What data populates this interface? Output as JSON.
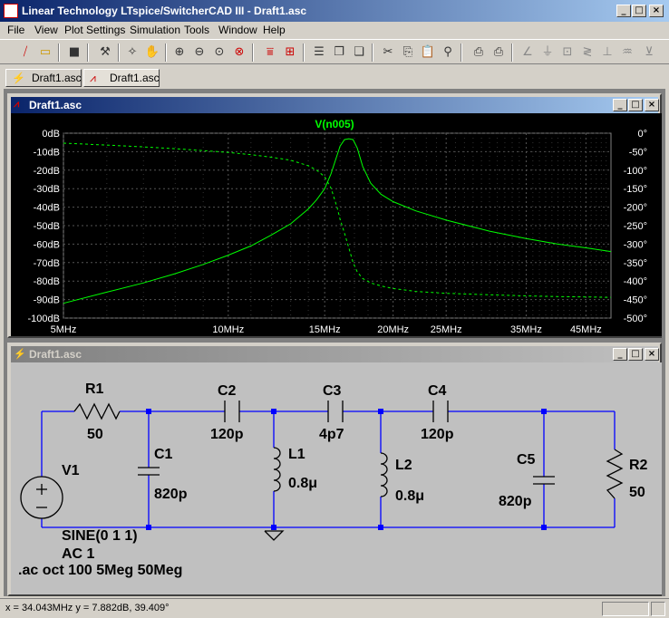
{
  "app": {
    "title": "Linear Technology LTspice/SwitcherCAD III - Draft1.asc",
    "min": "_",
    "max": "□",
    "close": "×"
  },
  "menu": [
    "File",
    "View",
    "Plot Settings",
    "Simulation",
    "Tools",
    "Window",
    "Help"
  ],
  "tabs": [
    {
      "label": "Draft1.asc",
      "icon": "schematic-icon"
    },
    {
      "label": "Draft1.asc",
      "icon": "waveform-icon"
    }
  ],
  "plot_window": {
    "title": "Draft1.asc",
    "trace_name": "V(n005)"
  },
  "schematic_window": {
    "title": "Draft1.asc"
  },
  "chart_data": {
    "type": "line",
    "title": "V(n005)",
    "x_scale": "log",
    "x_tick_labels": [
      "5MHz",
      "10MHz",
      "15MHz",
      "20MHz",
      "25MHz",
      "35MHz",
      "45MHz"
    ],
    "x_ticks": [
      5,
      10,
      15,
      20,
      25,
      35,
      45
    ],
    "xlim": [
      5,
      50
    ],
    "y_left_ticks": [
      "0dB",
      "-10dB",
      "-20dB",
      "-30dB",
      "-40dB",
      "-50dB",
      "-60dB",
      "-70dB",
      "-80dB",
      "-90dB",
      "-100dB"
    ],
    "ylim_left": [
      -100,
      0
    ],
    "y_right_ticks": [
      "0°",
      "-50°",
      "-100°",
      "-150°",
      "-200°",
      "-250°",
      "-300°",
      "-350°",
      "-400°",
      "-450°",
      "-500°"
    ],
    "ylim_right": [
      -500,
      0
    ],
    "grid": true,
    "series": [
      {
        "style": "solid",
        "axis": "left",
        "x": [
          5,
          6,
          7,
          8,
          9,
          10,
          11,
          12,
          13,
          14,
          14.5,
          15,
          15.4,
          15.8,
          16.0,
          16.3,
          16.6,
          16.9,
          17.2,
          17.6,
          18.2,
          19,
          20,
          22,
          25,
          30,
          35,
          40,
          45,
          50
        ],
        "y": [
          -92,
          -86,
          -81,
          -76,
          -71,
          -66,
          -61,
          -55,
          -49,
          -41,
          -36,
          -30,
          -22,
          -12,
          -7,
          -3.5,
          -3,
          -3.5,
          -8,
          -18,
          -27,
          -33,
          -37,
          -42,
          -47,
          -53,
          -57,
          -60,
          -62,
          -64
        ]
      },
      {
        "style": "dashed",
        "axis": "right",
        "x": [
          5,
          6,
          7,
          8,
          9,
          10,
          11,
          12,
          13,
          14,
          14.5,
          15,
          15.4,
          15.8,
          16.0,
          16.3,
          16.6,
          16.9,
          17.2,
          17.6,
          18.2,
          19,
          20,
          22,
          25,
          30,
          35,
          40,
          45,
          50
        ],
        "y": [
          -27,
          -32,
          -37,
          -42,
          -47,
          -52,
          -58,
          -65,
          -73,
          -88,
          -100,
          -118,
          -148,
          -200,
          -232,
          -270,
          -310,
          -350,
          -375,
          -393,
          -405,
          -413,
          -420,
          -428,
          -433,
          -437,
          -440,
          -442,
          -443,
          -444
        ]
      }
    ]
  },
  "schematic": {
    "components": {
      "r1": {
        "name": "R1",
        "value": "50"
      },
      "c1": {
        "name": "C1",
        "value": "820p"
      },
      "c2": {
        "name": "C2",
        "value": "120p"
      },
      "c3": {
        "name": "C3",
        "value": "4p7"
      },
      "c4": {
        "name": "C4",
        "value": "120p"
      },
      "c5": {
        "name": "C5",
        "value": "820p"
      },
      "l1": {
        "name": "L1",
        "value": "0.8μ"
      },
      "l2": {
        "name": "L2",
        "value": "0.8μ"
      },
      "r2": {
        "name": "R2",
        "value": "50"
      },
      "v1": {
        "name": "V1",
        "value": "SINE(0 1 1)",
        "ac": "AC 1"
      }
    },
    "directive": ".ac oct 100 5Meg 50Meg",
    "colors": {
      "wire": "#0000ff",
      "component": "#000000",
      "junction": "#0000ff"
    }
  },
  "status": {
    "cursor": "x = 34.043MHz    y = 7.882dB, 39.409°"
  },
  "colors": {
    "plot_bg": "#000000",
    "trace": "#00ff00",
    "grid": "#555555",
    "schematic_bg": "#c0c0c0"
  }
}
